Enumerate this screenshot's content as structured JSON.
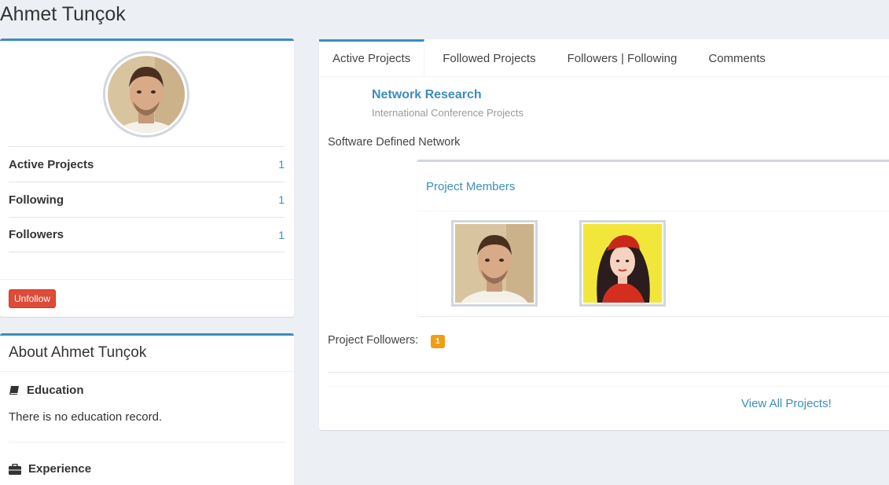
{
  "page": {
    "title": "Ahmet Tunçok"
  },
  "profile": {
    "avatar_alt": "Ahmet Tunçok",
    "stats": [
      {
        "label": "Active Projects",
        "value": "1"
      },
      {
        "label": "Following",
        "value": "1"
      },
      {
        "label": "Followers",
        "value": "1"
      }
    ],
    "unfollow_label": "Unfollow"
  },
  "about": {
    "title": "About Ahmet Tunçok",
    "education_title": "Education",
    "education_icon": "book-icon",
    "education_text": "There is no education record.",
    "experience_title": "Experience",
    "experience_icon": "briefcase-icon"
  },
  "tabs": [
    {
      "label": "Active Projects",
      "active": true
    },
    {
      "label": "Followed Projects",
      "active": false
    },
    {
      "label": "Followers | Following",
      "active": false
    },
    {
      "label": "Comments",
      "active": false
    }
  ],
  "project": {
    "title": "Network Research",
    "subtitle": "International Conference Projects",
    "description": "Software Defined Network",
    "members_title": "Project Members",
    "followers_label": "Project Followers:",
    "followers_count": "1"
  },
  "footer": {
    "view_all_label": "View All Projects!"
  },
  "colors": {
    "accent": "#3c8dbc",
    "danger": "#dd4b39",
    "warning": "#f39c12",
    "background": "#ecf0f5"
  }
}
